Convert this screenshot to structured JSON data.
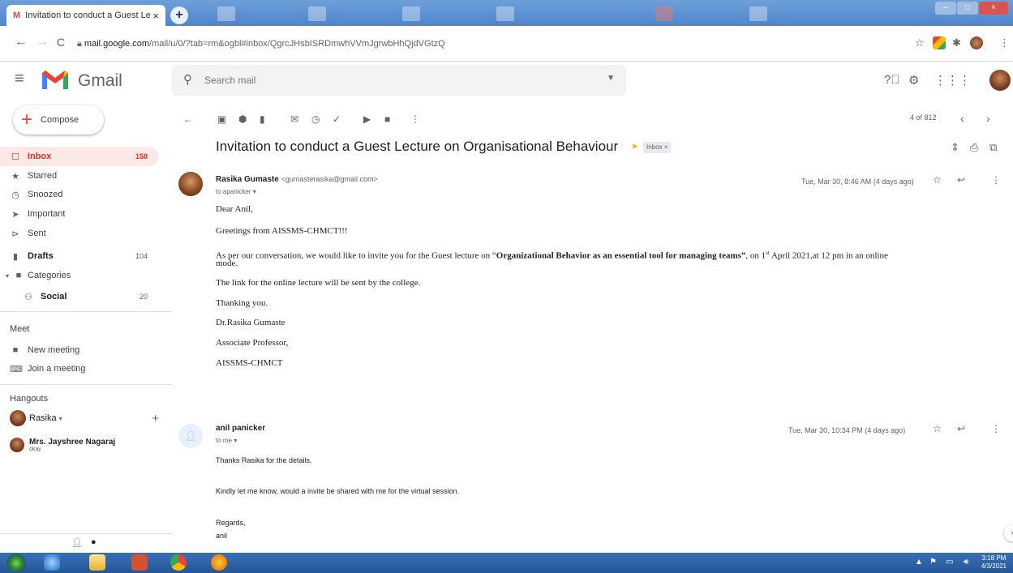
{
  "browser": {
    "tab_title": "Invitation to conduct a Guest Le",
    "tab_close": "×",
    "new_tab": "+",
    "url_domain": "mail.google.com",
    "url_path": "/mail/u/0/?tab=rm&ogbl#inbox/QgrcJHsbISRDmwhVVmJgrwbHhQjdVGtzQ",
    "back": "←",
    "forward": "→",
    "reload": "C"
  },
  "header": {
    "brand": "Gmail",
    "search_placeholder": "Search mail"
  },
  "sidebar": {
    "compose": "Compose",
    "items": [
      {
        "label": "Inbox",
        "count": "158",
        "icon": "inbox-icon"
      },
      {
        "label": "Starred",
        "count": "",
        "icon": "star-icon"
      },
      {
        "label": "Snoozed",
        "count": "",
        "icon": "clock-icon"
      },
      {
        "label": "Important",
        "count": "",
        "icon": "important-icon"
      },
      {
        "label": "Sent",
        "count": "",
        "icon": "send-icon"
      },
      {
        "label": "Drafts",
        "count": "104",
        "icon": "draft-icon"
      },
      {
        "label": "Categories",
        "count": "",
        "icon": "label-icon"
      },
      {
        "label": "Social",
        "count": "20",
        "icon": "people-icon"
      }
    ],
    "meet_heading": "Meet",
    "new_meeting": "New meeting",
    "join_meeting": "Join a meeting",
    "hangouts_heading": "Hangouts",
    "hangouts_user": "Rasika",
    "hangouts_user_caret": "▾",
    "add": "+",
    "contact_name": "Mrs. Jayshree Nagaraj",
    "contact_status": "okay"
  },
  "toolbar": {
    "pager": "4 of 812",
    "prev": "‹",
    "next": "›"
  },
  "thread": {
    "subject": "Invitation to conduct a Guest Lecture on Organisational Behaviour",
    "label": "Inbox ×",
    "messages": [
      {
        "sender": "Rasika Gumaste",
        "email": "<gumasterasika@gmail.com>",
        "to": "to apanicker ▾",
        "date": "Tue, Mar 30, 8:46 AM (4 days ago)",
        "greeting": "Dear Anil,",
        "line1": "Greetings from AISSMS-CHMCT!!!",
        "line2a": "As per our conversation, we would like to invite you for the Guest lecture on “",
        "line2b": "Organizational Behavior as an essential tool for managing teams”",
        "line2c": ", on 1",
        "line2sup": "st",
        "line2d": " April 2021,at 12 pm in an online",
        "line2e": "mode.",
        "line3": "The link for the online lecture will be sent by the college.",
        "line4": "Thanking you.",
        "line5": "Dr.Rasika Gumaste",
        "line6": "Associate Professor,",
        "line7": "AISSMS-CHMCT"
      },
      {
        "sender": "anil panicker",
        "to": "to me ▾",
        "date": "Tue, Mar 30, 10:34 PM (4 days ago)",
        "line1": "Thanks Rasika for the details.",
        "line2": "Kindly let me know, would a invite be shared with me for the virtual session.",
        "line3": "Regards,",
        "line4": "anil"
      }
    ]
  },
  "taskbar": {
    "time": "3:18 PM",
    "date": "4/3/2021"
  },
  "colors": {
    "gmail_red": "#ea4335",
    "inbox_active_bg": "#fce8e6",
    "taskbar_blue": "#24579a"
  }
}
